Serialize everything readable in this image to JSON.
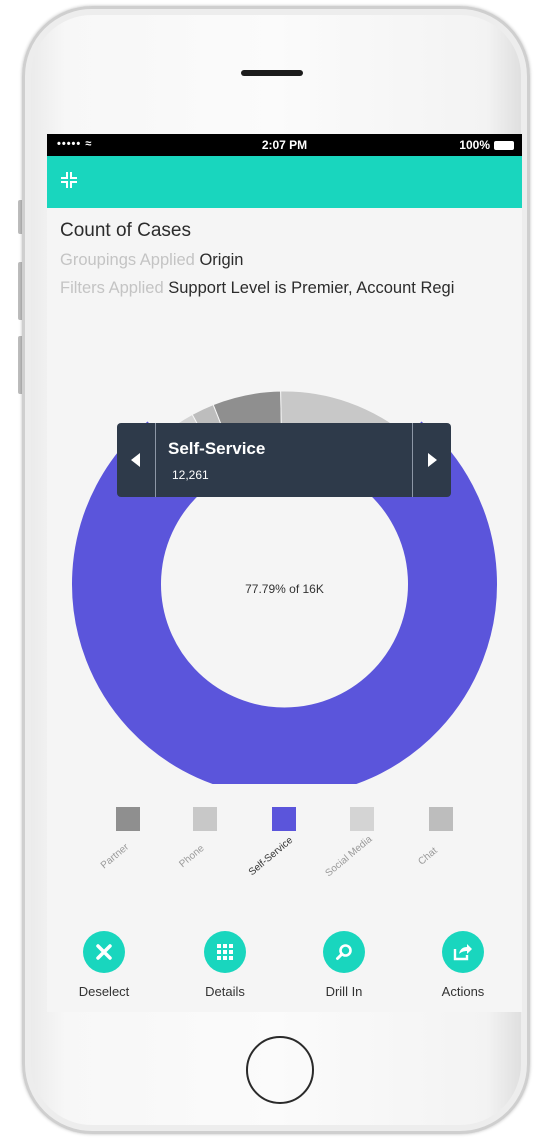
{
  "status_bar": {
    "signal": "••••• ≈",
    "time": "2:07 PM",
    "battery": "100%"
  },
  "app_bar": {
    "accent": "#19d6be",
    "collapse_icon": "collapse-icon"
  },
  "report": {
    "title": "Count of Cases",
    "groupings_label": "Groupings Applied",
    "groupings_value": "Origin",
    "filters_label": "Filters Applied",
    "filters_value": "Support Level is Premier, Account Regi"
  },
  "tooltip": {
    "name": "Self-Service",
    "value": "12,261"
  },
  "center_text": "77.79% of 16K",
  "legend": [
    "Partner",
    "Phone",
    "Self-Service",
    "Social Media",
    "Chat"
  ],
  "actions": [
    {
      "label": "Deselect",
      "icon": "close-icon"
    },
    {
      "label": "Details",
      "icon": "grid-icon"
    },
    {
      "label": "Drill In",
      "icon": "zoom-icon"
    },
    {
      "label": "Actions",
      "icon": "share-icon"
    }
  ],
  "chart_data": {
    "type": "pie",
    "title": "Count of Cases",
    "categories": [
      "Partner",
      "Phone",
      "Self-Service",
      "Social Media",
      "Chat"
    ],
    "values": [
      900,
      1800,
      12261,
      500,
      300
    ],
    "selected": "Self-Service",
    "colors": {
      "selected": "#5b55db",
      "unselected": [
        "#8f8f8f",
        "#c8c8c8",
        "#d4d4d4",
        "#bdbdbd"
      ]
    }
  }
}
